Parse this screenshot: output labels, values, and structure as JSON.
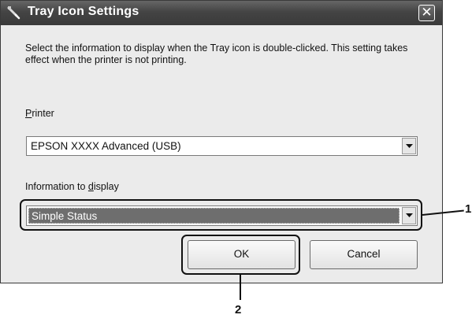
{
  "window": {
    "title": "Tray Icon Settings",
    "close_glyph": "✕",
    "description": "Select the information to display when the Tray icon is double-clicked. This setting takes effect when the printer is not printing."
  },
  "printer": {
    "label_underlined": "P",
    "label_rest": "rinter",
    "selected_value": "EPSON XXXX Advanced (USB)"
  },
  "info_display": {
    "label_before": "Information to ",
    "label_underlined": "d",
    "label_after": "isplay",
    "selected_value": "Simple Status"
  },
  "buttons": {
    "ok_label": "OK",
    "cancel_label": "Cancel"
  },
  "callouts": {
    "one": "1",
    "two": "2"
  },
  "icons": {
    "title_icon": "wrench-icon",
    "close_icon": "close-icon",
    "dropdown_icon": "chevron-down-icon"
  },
  "colors": {
    "titlebar": "#444444",
    "dialog_bg": "#ebebeb",
    "selection_bg": "#6e6e6e"
  }
}
